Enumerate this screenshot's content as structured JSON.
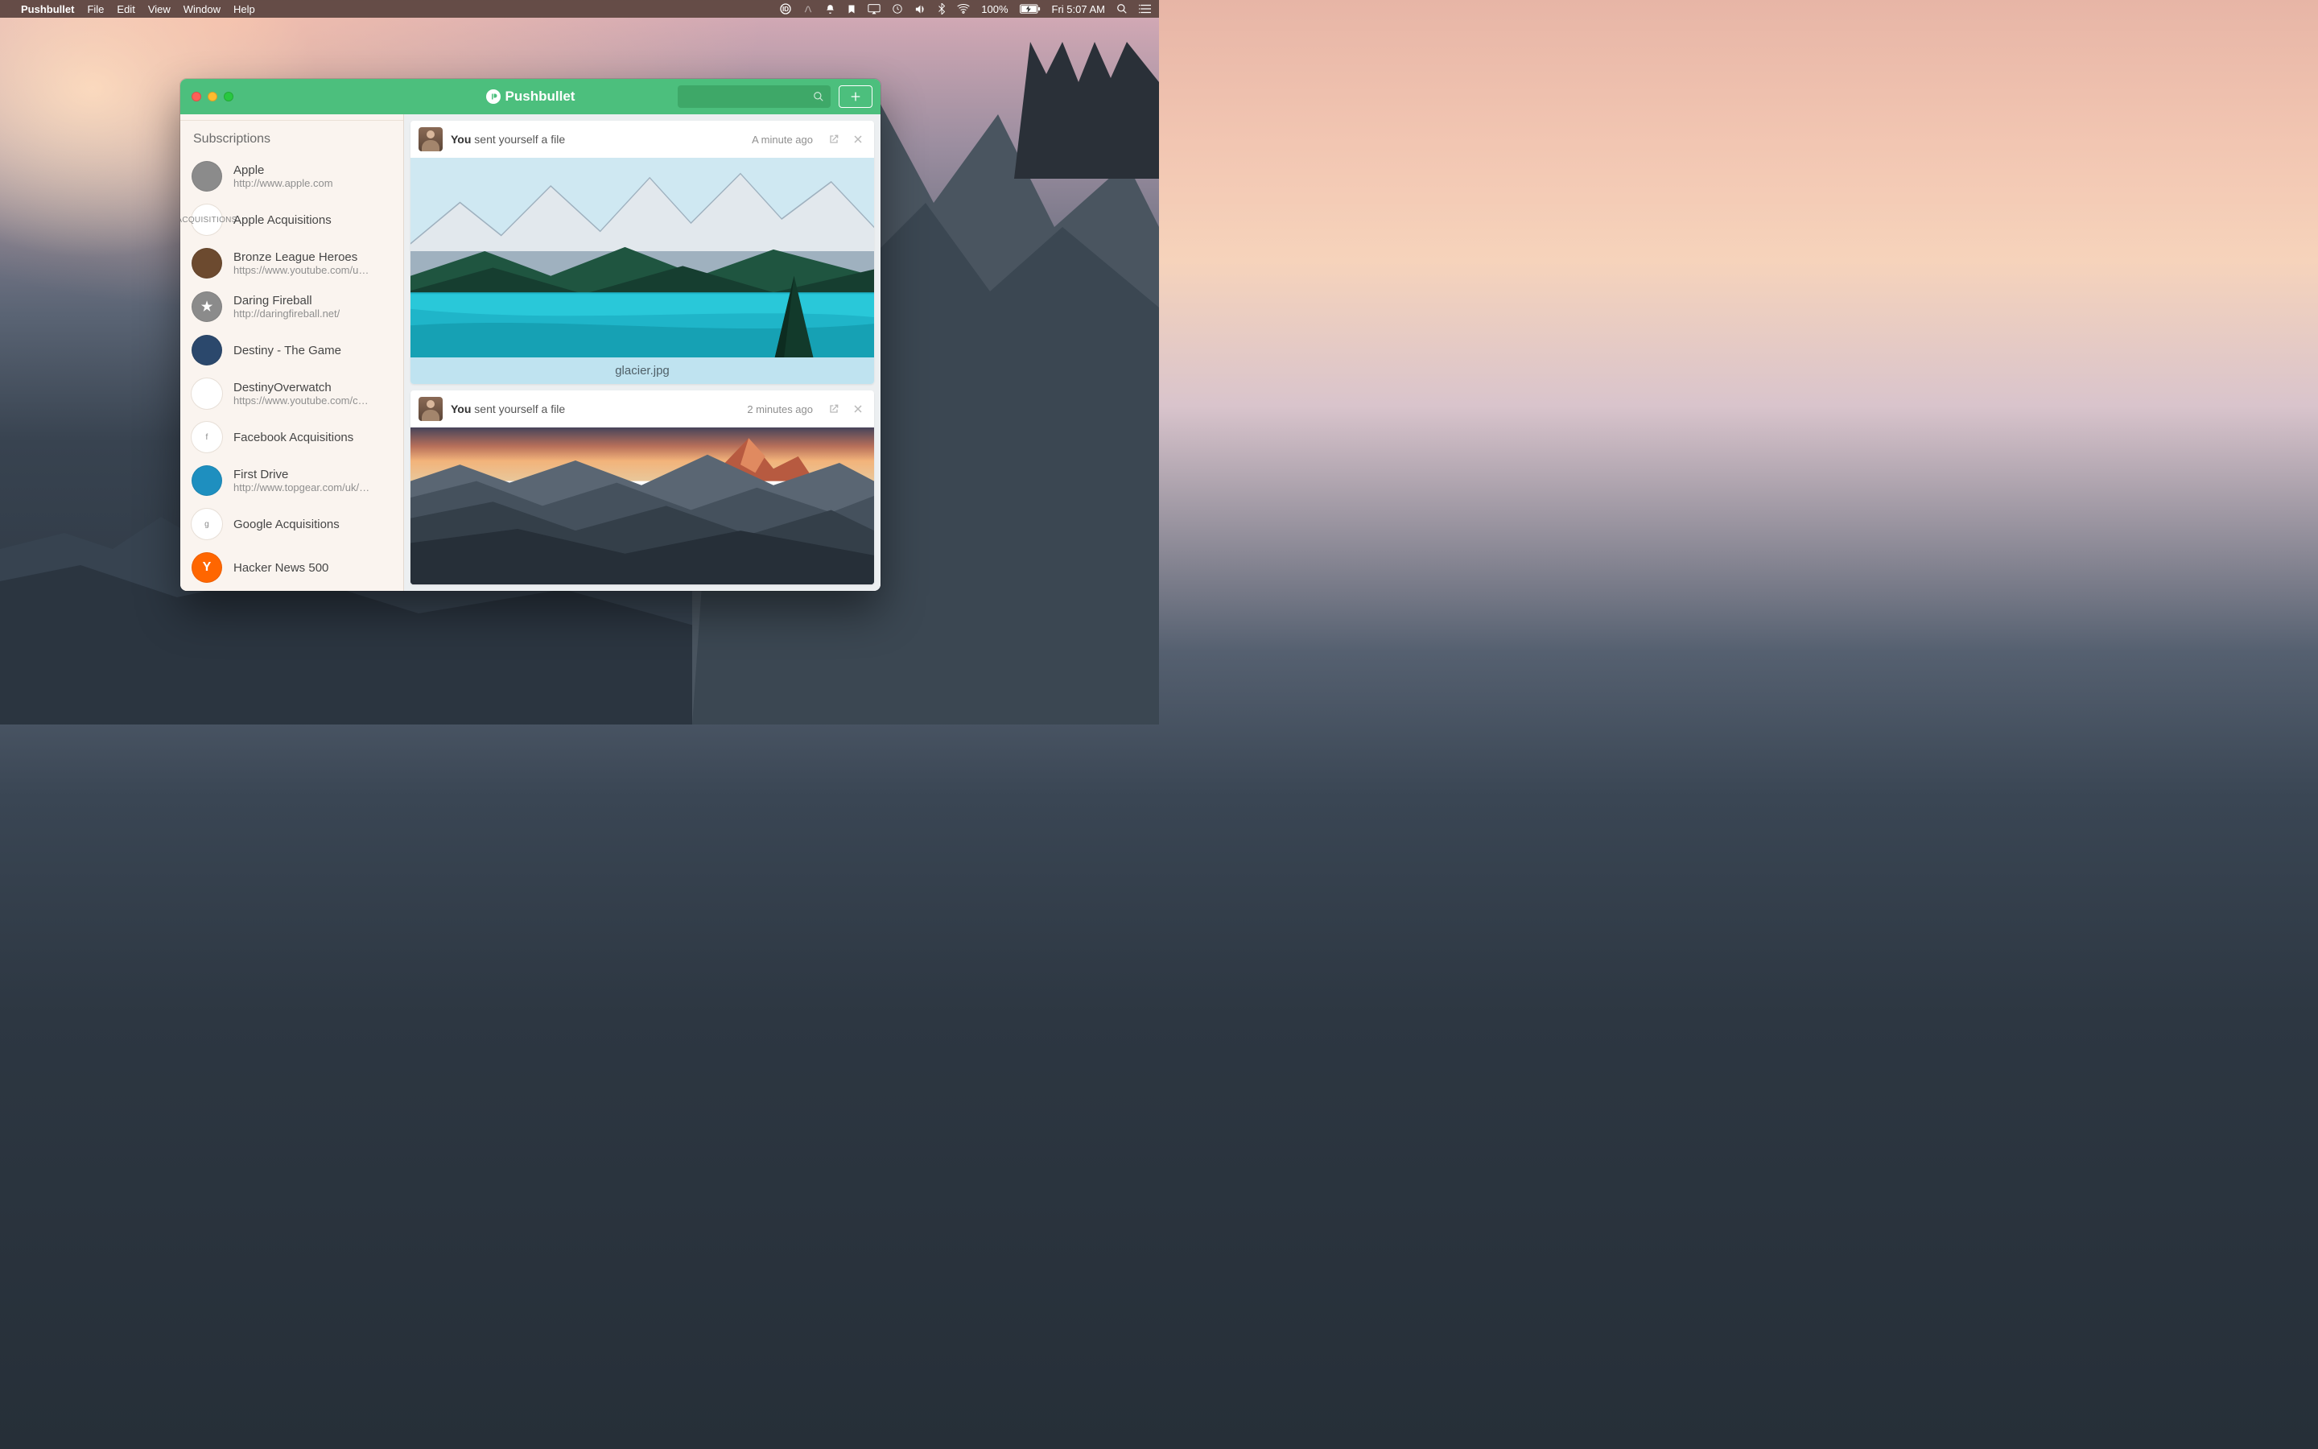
{
  "menubar": {
    "app": "Pushbullet",
    "menus": [
      "File",
      "Edit",
      "View",
      "Window",
      "Help"
    ],
    "battery": "100%",
    "clock": "Fri 5:07 AM"
  },
  "window": {
    "title": "Pushbullet"
  },
  "sidebar": {
    "header": "Subscriptions",
    "items": [
      {
        "name": "Apple",
        "url": "http://www.apple.com",
        "avatar_bg": "#8b8b8b",
        "avatar_text": "",
        "avatar_class": ""
      },
      {
        "name": "Apple Acquisitions",
        "url": "",
        "avatar_bg": "#ffffff",
        "avatar_text": "ACQUISITIONS",
        "avatar_class": "white"
      },
      {
        "name": "Bronze League Heroes",
        "url": "https://www.youtube.com/u…",
        "avatar_bg": "#6c4a2f",
        "avatar_text": "",
        "avatar_class": ""
      },
      {
        "name": "Daring Fireball",
        "url": "http://daringfireball.net/",
        "avatar_bg": "#8b8b8b",
        "avatar_text": "★",
        "avatar_class": ""
      },
      {
        "name": "Destiny - The Game",
        "url": "",
        "avatar_bg": "#2b486c",
        "avatar_text": "",
        "avatar_class": ""
      },
      {
        "name": "DestinyOverwatch",
        "url": "https://www.youtube.com/c…",
        "avatar_bg": "#ffffff",
        "avatar_text": "",
        "avatar_class": "white"
      },
      {
        "name": "Facebook Acquisitions",
        "url": "",
        "avatar_bg": "#ffffff",
        "avatar_text": "f",
        "avatar_class": "white"
      },
      {
        "name": "First Drive",
        "url": "http://www.topgear.com/uk/…",
        "avatar_bg": "#1e8fbf",
        "avatar_text": "",
        "avatar_class": ""
      },
      {
        "name": "Google Acquisitions",
        "url": "",
        "avatar_bg": "#ffffff",
        "avatar_text": "g",
        "avatar_class": "white"
      },
      {
        "name": "Hacker News 500",
        "url": "",
        "avatar_bg": "#ff6600",
        "avatar_text": "Y",
        "avatar_class": ""
      }
    ]
  },
  "feed": [
    {
      "sender": "You",
      "action": "sent yourself a file",
      "time": "A minute ago",
      "caption": "glacier.jpg",
      "show_caption": true,
      "image_kind": "glacier"
    },
    {
      "sender": "You",
      "action": "sent yourself a file",
      "time": "2 minutes ago",
      "caption": "",
      "show_caption": false,
      "image_kind": "yosemite"
    }
  ]
}
